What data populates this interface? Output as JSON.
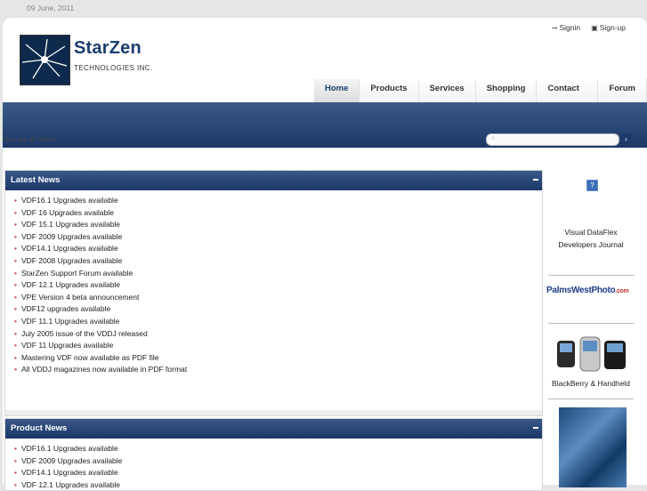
{
  "date": "09 June, 2011",
  "logo": {
    "name": "StarZen",
    "subtitle": "TECHNOLOGIES INC."
  },
  "toplinks": {
    "signin": "Signin",
    "signup": "Sign-up"
  },
  "nav": [
    "Home",
    "Products",
    "Services",
    "Shopping",
    "Contact Us",
    "Forum"
  ],
  "breadcrumb": "Your are @  Home",
  "search": {
    "placeholder": ""
  },
  "latest_news": {
    "title": "Latest News",
    "items": [
      "VDF16.1 Upgrades available",
      "VDF 16 Upgrades available",
      "VDF 15.1 Upgrades available",
      "VDF 2009 Upgrades available",
      "VDF14.1 Upgrades available",
      "VDF 2008 Upgrades available",
      "StarZen Support Forum available",
      "VDF 12.1 Upgrades available",
      "VPE Version 4 beta announcement",
      "VDF12 upgrades available",
      "VDF 11.1 Upgrades available",
      "July 2005 issue of the VDDJ released",
      "VDF 11 Upgrades available",
      "Mastering VDF now available as PDF file",
      "All VDDJ magazines now available in PDF format"
    ]
  },
  "product_news": {
    "title": "Product News",
    "items": [
      "VDF16.1 Upgrades available",
      "VDF 2009 Upgrades available",
      "VDF14.1 Upgrades available",
      "VDF 12.1 Upgrades available"
    ]
  },
  "sidebar": {
    "journal_line1": "Visual DataFlex",
    "journal_line2": "Developers Journal",
    "palms_text": "PalmsWestPhoto",
    "palms_suffix": ".com",
    "bb_caption": "BlackBerry & Handheld",
    "qicon": "?"
  },
  "colors": {
    "nav_band": "#1b3867",
    "brand": "#1a3d6e",
    "bullet": "#cc3333"
  }
}
